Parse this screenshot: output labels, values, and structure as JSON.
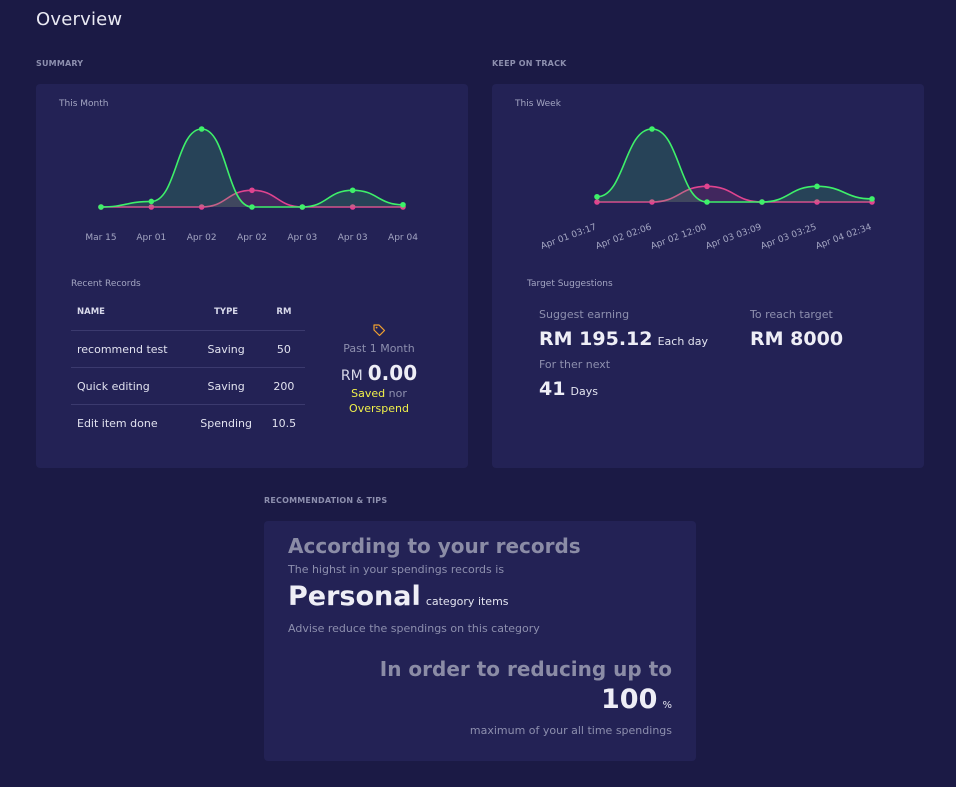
{
  "page": {
    "title": "Overview"
  },
  "summary": {
    "section_label": "SUMMARY",
    "card_title": "This Month",
    "chart_data": {
      "type": "area",
      "categories": [
        "Mar 15",
        "Apr 01",
        "Apr 02",
        "Apr 02",
        "Apr 03",
        "Apr 03",
        "Apr 04"
      ],
      "series": [
        {
          "color": "#3ef06a",
          "values": [
            0,
            5,
            70,
            0,
            0,
            15,
            2
          ]
        },
        {
          "color": "#e0448f",
          "values": [
            0,
            0,
            0,
            15,
            0,
            0,
            0
          ]
        }
      ],
      "grid": false
    },
    "records_title": "Recent Records",
    "records": {
      "columns": [
        "NAME",
        "TYPE",
        "RM"
      ],
      "rows": [
        {
          "name": "recommend test",
          "type": "Saving",
          "rm": "50"
        },
        {
          "name": "Quick editing",
          "type": "Saving",
          "rm": "200"
        },
        {
          "name": "Edit item done",
          "type": "Spending",
          "rm": "10.5"
        }
      ]
    },
    "period": {
      "icon": "tag-icon",
      "label": "Past 1 Month",
      "currency": "RM",
      "amount": "0.00",
      "saved": "Saved",
      "nor": "nor",
      "overspend": "Overspend"
    }
  },
  "keep_on_track": {
    "section_label": "KEEP ON TRACK",
    "card_title": "This Week",
    "chart_data": {
      "type": "area",
      "categories": [
        "Apr 01 03:17",
        "Apr 02 02:06",
        "Apr 02 12:00",
        "Apr 03 03:09",
        "Apr 03 03:25",
        "Apr 04 02:34"
      ],
      "series": [
        {
          "color": "#3ef06a",
          "values": [
            5,
            70,
            0,
            0,
            15,
            3
          ]
        },
        {
          "color": "#e0448f",
          "values": [
            0,
            0,
            15,
            0,
            0,
            0
          ]
        }
      ],
      "grid": false
    },
    "target_title": "Target Suggestions",
    "suggest_label": "Suggest earning",
    "suggest_value": "RM 195.12",
    "suggest_unit": "Each day",
    "next_label": "For ther next",
    "days_value": "41",
    "days_unit": "Days",
    "reach_label": "To reach target",
    "reach_value": "RM 8000"
  },
  "tips": {
    "section_label": "RECOMMENDATION & TIPS",
    "heading": "According to your records",
    "highest_text": "The highst in your spendings records is",
    "category": "Personal",
    "category_suffix": "category items",
    "advise": "Advise reduce the spendings on this category",
    "reduce_heading": "In order to reducing up to",
    "percent_value": "100",
    "percent_unit": "%",
    "footer": "maximum of your all time spendings"
  }
}
